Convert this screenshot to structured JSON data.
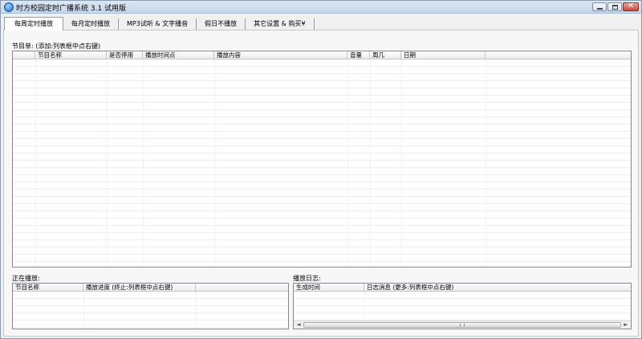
{
  "window": {
    "title": "时方校园定时广播系统 3.1 试用版"
  },
  "tabs": [
    {
      "label": "每周定时播放",
      "active": true
    },
    {
      "label": "每月定时播放",
      "active": false
    },
    {
      "label": "MP3试听 & 文字播音",
      "active": false
    },
    {
      "label": "假日不播放",
      "active": false
    },
    {
      "label": "其它设置 & 购买¥",
      "active": false
    }
  ],
  "program_list": {
    "label": "节目单:  (添加:列表框中点右键)",
    "columns": [
      "",
      "节目名称",
      "是否停用",
      "播放时间点",
      "播放内容",
      "音量",
      "周几",
      "日期",
      ""
    ]
  },
  "now_playing": {
    "label": "正在播放:",
    "columns": [
      "节目名称",
      "播放进度 (终止:列表框中点右键)",
      ""
    ]
  },
  "play_log": {
    "label": "播放日志:",
    "columns": [
      "生成时间",
      "日志消息 (更多:列表框中点右键)"
    ],
    "scroll_left": "◄",
    "scroll_right": "►"
  }
}
